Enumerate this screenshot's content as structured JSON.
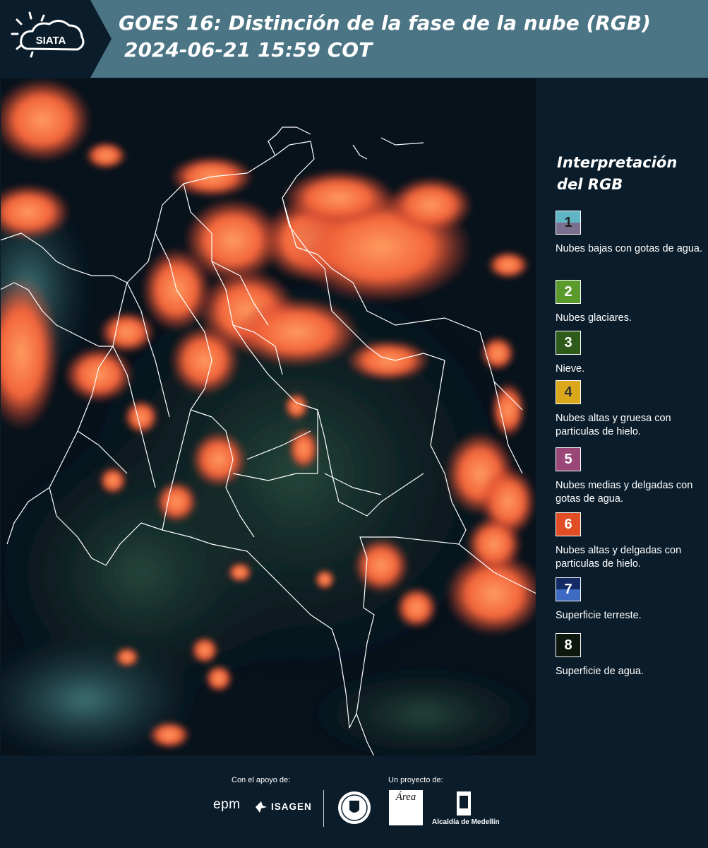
{
  "header": {
    "logo_text": "SIATA",
    "title_line1": "GOES 16: Distinción de la fase de la nube (RGB)",
    "title_line2": "2024-06-21 15:59 COT"
  },
  "legend": {
    "title": "Interpretación del RGB",
    "items": [
      {
        "num": "1",
        "label": "Nubes bajas con gotas de agua.",
        "color_top": "#5fb6c5",
        "color_bottom": "#7b7090"
      },
      {
        "num": "2",
        "label": "Nubes glaciares.",
        "color_top": "#5a9b2c",
        "color_bottom": "#5a9b2c"
      },
      {
        "num": "3",
        "label": "Nieve.",
        "color_top": "#2e5a1a",
        "color_bottom": "#2e5a1a"
      },
      {
        "num": "4",
        "label": "Nubes altas y gruesa con particulas de hielo.",
        "color_top": "#dba81c",
        "color_bottom": "#dba81c"
      },
      {
        "num": "5",
        "label": "Nubes medias y delgadas con gotas de agua.",
        "color_top": "#9a4678",
        "color_bottom": "#9a4678"
      },
      {
        "num": "6",
        "label": "Nubes altas y delgadas con particulas de hielo.",
        "color_top": "#e14d25",
        "color_bottom": "#e14d25"
      },
      {
        "num": "7",
        "label": "Superficie terreste.",
        "color_top": "#142a66",
        "color_bottom": "#3d6bc4"
      },
      {
        "num": "8",
        "label": "Superficie de agua.",
        "color_top": "#0d170d",
        "color_bottom": "#0d170d"
      }
    ]
  },
  "footer": {
    "support_label": "Con el apoyo de:",
    "project_label": "Un proyecto de:",
    "epm": "epm",
    "isagen": "ISAGEN",
    "area_logo": "Área",
    "alcaldia": "Alcaldía de Medellín"
  },
  "colors": {
    "header_bg": "#4b7584",
    "panel_bg": "#0b1d2b",
    "cloud_orange": "#f2643a",
    "border_white": "#ffffff"
  }
}
